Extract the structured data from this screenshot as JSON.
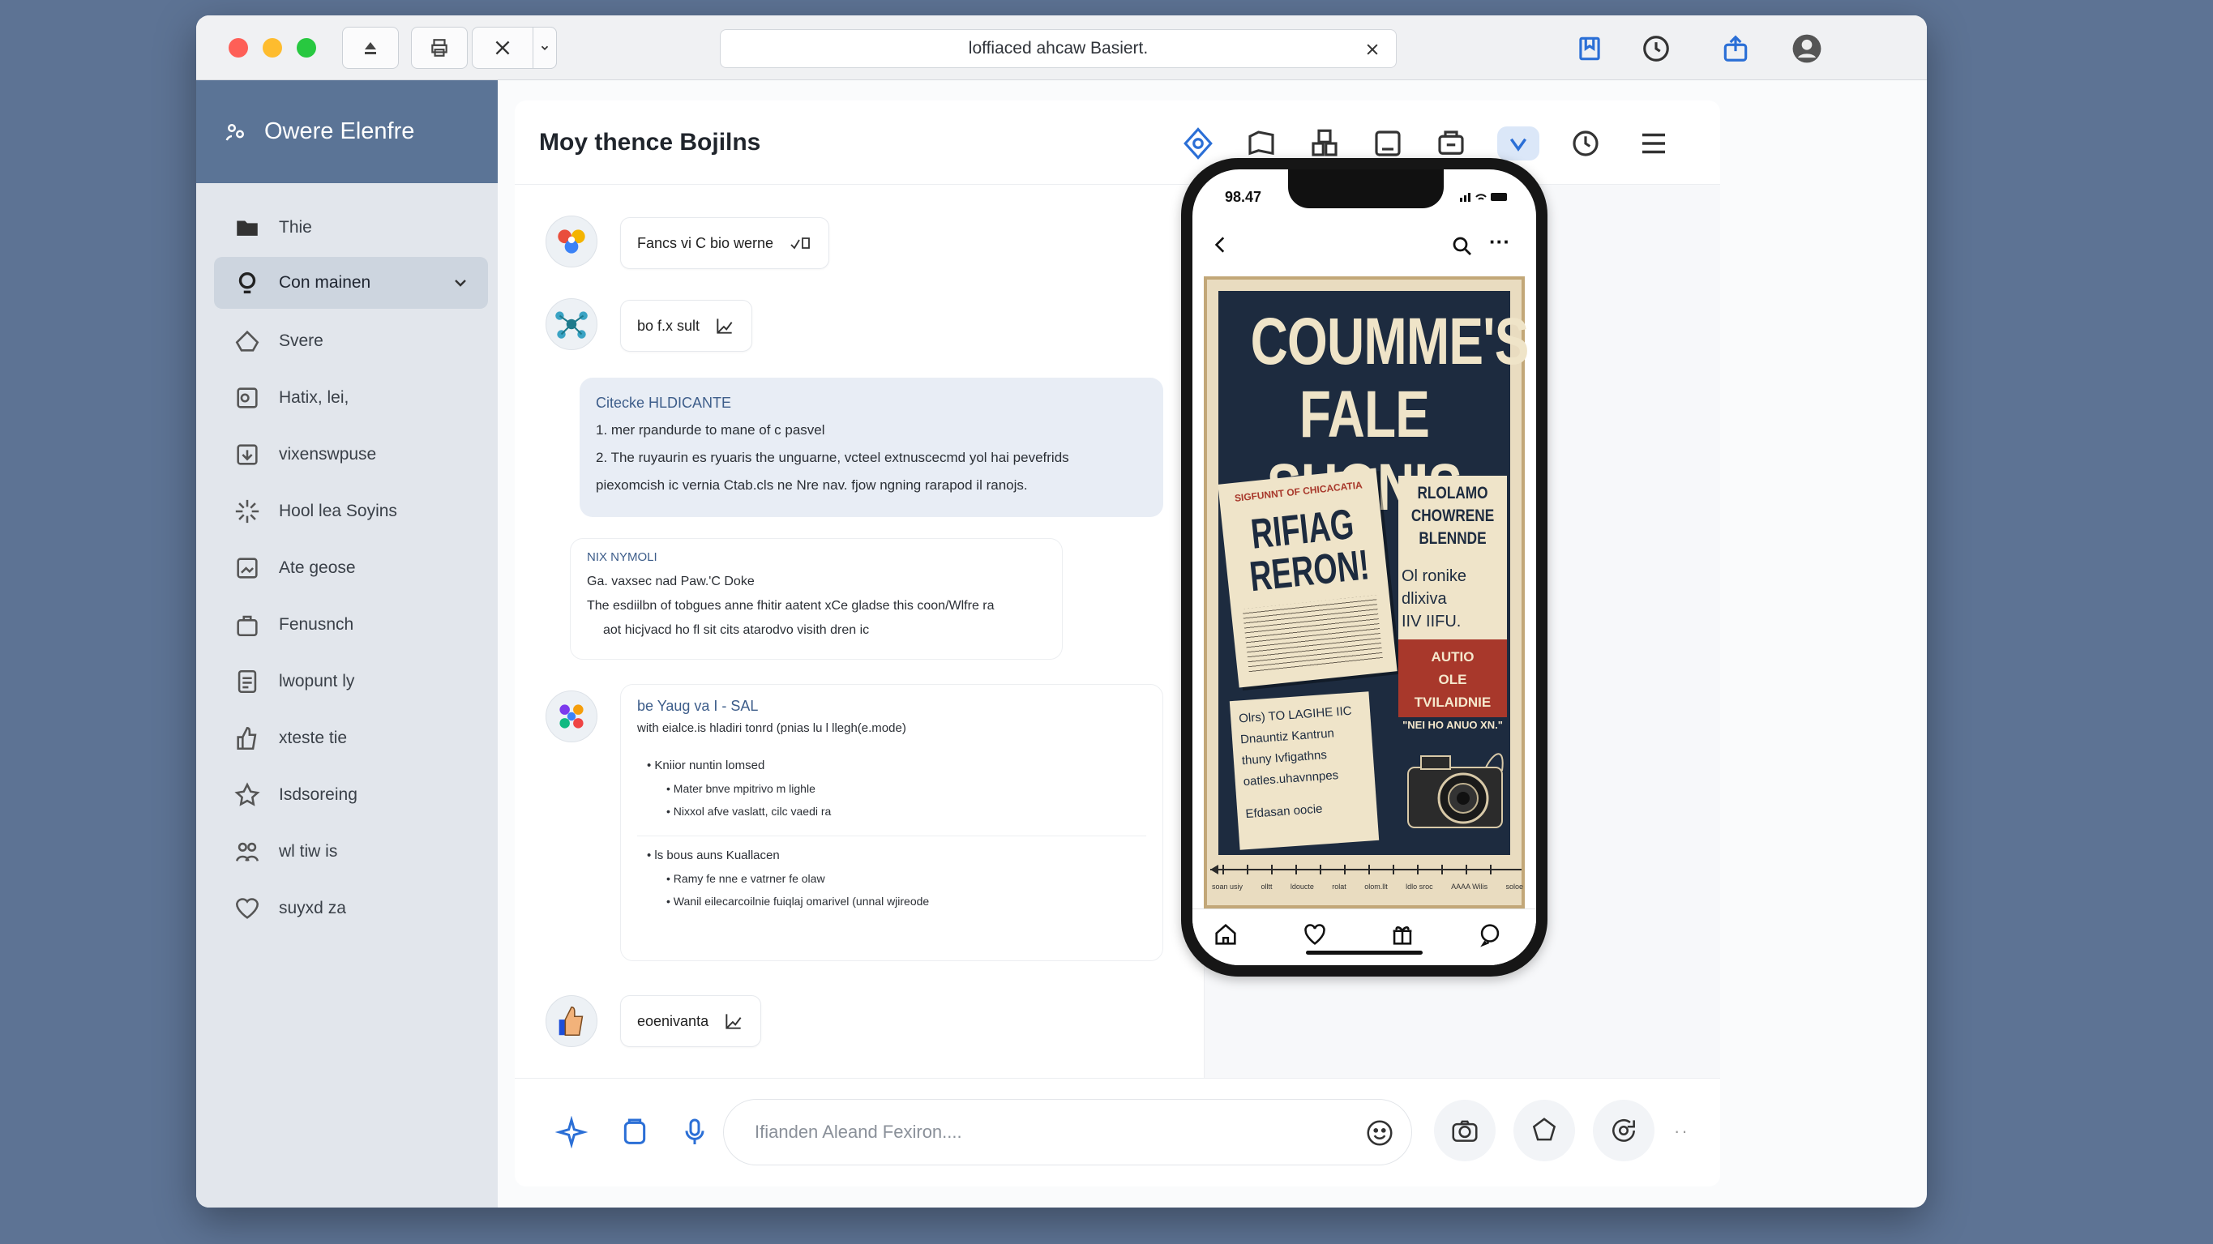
{
  "window": {
    "address": "loffiaced ahcaw Basiert.",
    "toolbar_icons": [
      "eject-icon",
      "print-icon",
      "close-icon",
      "chevron-down-icon"
    ],
    "right_icons": [
      "bookmark-icon",
      "clock-icon",
      "share-icon",
      "avatar-icon"
    ]
  },
  "sidebar": {
    "title": "Owere Elenfre",
    "items": [
      {
        "label": "Thie",
        "icon": "folder-icon"
      },
      {
        "label": "Con mainen",
        "icon": "bulb-icon",
        "active": true
      },
      {
        "label": "Svere",
        "icon": "home-icon"
      },
      {
        "label": "Hatix, lei,",
        "icon": "contact-icon"
      },
      {
        "label": "vixenswpuse",
        "icon": "download-icon"
      },
      {
        "label": "Hool lea Soyins",
        "icon": "sparkle-icon"
      },
      {
        "label": "Ate geose",
        "icon": "image-icon"
      },
      {
        "label": "Fenusnch",
        "icon": "bag-icon"
      },
      {
        "label": "lwopunt ly",
        "icon": "document-icon"
      },
      {
        "label": "xteste tie",
        "icon": "thumb-icon"
      },
      {
        "label": "Isdsoreing",
        "icon": "star-icon"
      },
      {
        "label": "wl tiw is",
        "icon": "group-icon"
      },
      {
        "label": "suyxd za",
        "icon": "heart-icon"
      }
    ]
  },
  "panel": {
    "title": "Moy thence Bojilns",
    "header_icons": [
      "target-icon",
      "flag-icon",
      "grid-icon",
      "tablet-icon",
      "print-icon",
      "chevron-down-icon",
      "history-icon",
      "menu-icon"
    ]
  },
  "chat": {
    "msg1": "Fancs vi C bio werne",
    "msg2": "bo f.x sult",
    "card1": {
      "title": "Citecke HLDICANTE",
      "lines": [
        "1. mer rpandurde to mane of c pasvel",
        "2. The ruyaurin es ryuaris the unguarne, vcteel extnuscecmd yol hai pevefrids",
        "piexomcish ic vernia Ctab.cls ne Nre nav. fjow ngning rarapod il ranojs."
      ]
    },
    "card2": {
      "title": "NIX NYMOLI",
      "lines": [
        "Ga. vaxsec nad Paw.'C Doke",
        "The esdiilbn of tobgues anne fhitir aatent xCe gladse this coon/Wlfre ra",
        "aot hicjvacd ho fl sit cits atarodvo visith dren ic"
      ]
    },
    "card3": {
      "title": "be Yaug va I - SAL",
      "subtitle": "with eialce.is hladiri tonrd (pnias lu l llegh(e.mode)",
      "group1": {
        "head": "Kniior nuntin lomsed",
        "items": [
          "Mater bnve mpitrivo m lighle",
          "Nixxol afve vaslatt, cilc vaedi ra"
        ]
      },
      "group2": {
        "head": "ls bous auns Kuallacen",
        "items": [
          "Ramy fe nne e vatrner fe olaw",
          "Wanil eilecarcoilnie fuiqlaj omarivel (unnal wjireode"
        ]
      }
    },
    "msg4": "eoenivanta"
  },
  "phone": {
    "time": "98.47",
    "poster": {
      "title1": "COUMME'S",
      "title2": "FALE SHONIS",
      "paper1_small": "SIGFUNNT OF CHICACATIA",
      "paper1_big1": "RIFIAG",
      "paper1_big2": "RERON!",
      "right_block": [
        "RLOLAMO",
        "CHOWRENE",
        "BLENNDE"
      ],
      "right_block2": [
        "Ol ronike",
        "dlixiva",
        "IIV IIFU."
      ],
      "red_block": [
        "AUTIO",
        "OLE TVILAIDNIE",
        "\"NEI HO ANUO XN.\""
      ],
      "paper2_lines": [
        "Olrs) TO LAGIHE IIC",
        "Dnauntiz Kantrun",
        "thuny Ivfigathns",
        "oatles.uhavnnpes",
        "Efdasan oocie"
      ],
      "timeline_labels": [
        "soan usiy",
        "olltt",
        "ldoucte",
        "rolat",
        "olom.llt",
        "ldlo sroc",
        "AAAA Wilis",
        "soloe"
      ]
    }
  },
  "composer": {
    "placeholder": "Ifianden Aleand Fexiron...."
  }
}
